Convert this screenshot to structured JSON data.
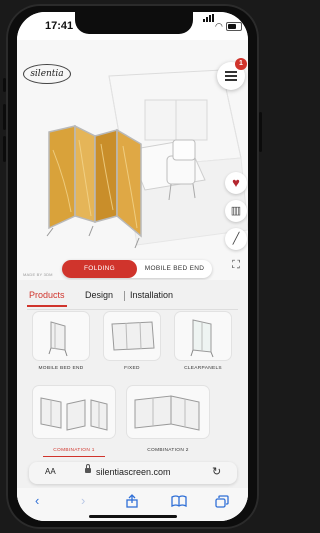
{
  "status_bar": {
    "time": "17:41"
  },
  "brand": {
    "logo_text": "silentia"
  },
  "menu": {
    "badge_count": "1"
  },
  "scene": {
    "tools": [
      {
        "icon": "heart-icon"
      },
      {
        "icon": "share-panel-icon"
      },
      {
        "icon": "measure-icon"
      },
      {
        "icon": "fullscreen-icon"
      }
    ],
    "toggle": {
      "selected": "FOLDING",
      "other": "MOBILE BED END"
    },
    "made_by": "MADE BY 3DM"
  },
  "tabs": [
    {
      "label": "Products",
      "active": true
    },
    {
      "label": "Design",
      "active": false
    },
    {
      "label": "Installation",
      "active": false
    }
  ],
  "products": [
    {
      "label": "MOBILE BED END",
      "active": false
    },
    {
      "label": "FIXED",
      "active": false
    },
    {
      "label": "CLEARPANELS",
      "active": false
    },
    {
      "label": "COMBINATION 1",
      "active": true
    },
    {
      "label": "COMBINATION 2",
      "active": false
    }
  ],
  "browser": {
    "aa": "AA",
    "url": "silentiascreen.com"
  },
  "colors": {
    "accent": "#d0342c",
    "panel_gold": "#d9a23a"
  }
}
